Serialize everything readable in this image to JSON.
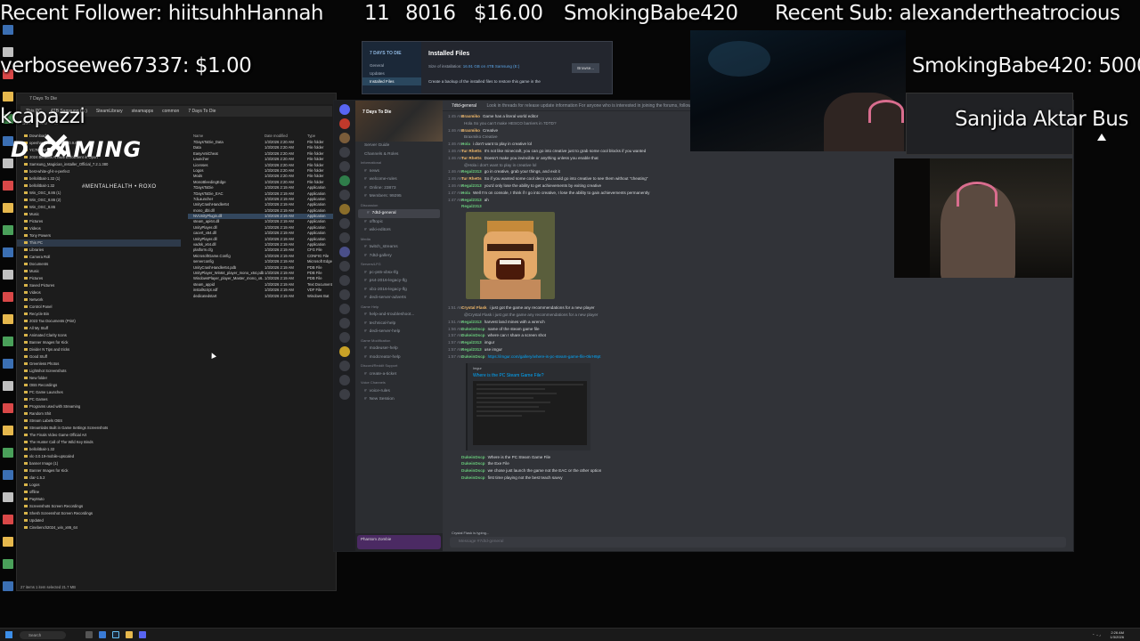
{
  "overlay": {
    "recent_follower": "Recent Follower: hiitsuhhHannah",
    "stat_a": "11",
    "stat_b": "8016",
    "stat_c": "$16.00",
    "top_donor": "SmokingBabe420",
    "recent_sub": "Recent Sub: alexandertheatrocious",
    "tip_line": "verboseewe67337: $1.00",
    "bits_line": "SmokingBabe420: 5000",
    "ticker_left": "kcapazzi",
    "ticker_right": "Sanjida Aktar Bus",
    "logo_text": "D  GAMING",
    "logo_tag": "#MENTALHEALTH • ROXO"
  },
  "steam": {
    "sidebar_title": "7 DAYS TO DIE",
    "sidebar_items": [
      "General",
      "Updates",
      "Installed Files"
    ],
    "heading": "Installed Files",
    "size_label": "Size of installation:",
    "size_value": "16.91 GB on 4TB Samsung (E:)",
    "browse": "Browse...",
    "backup_text": "Create a backup of the installed files to restore this game in the"
  },
  "explorer": {
    "title": "7 Days To Die",
    "address": [
      "This PC",
      "4TB Samsung (E:)",
      "SteamLibrary",
      "steamapps",
      "common",
      "7 Days To Die"
    ],
    "tools": [
      "Sort",
      "View",
      "..."
    ],
    "columns": [
      "Name",
      "Date modified",
      "Type"
    ],
    "nav": [
      "Downloads",
      "openhardwaremonitor-v0.9.6",
      "YC7B-192",
      "2024 Benefits Annual Enrollment in Oport",
      "Samsung_Magician_installer_Official_7.2.1.380",
      "best-white-gf-it-v-perfect",
      "bellolitbait-1.32 (1)",
      "bellolitbait-1.32",
      "Win_OSC_8.86 (1)",
      "Win_OSC_8.86 (2)",
      "Win_OSC_8.86",
      "Music",
      "Pictures",
      "Videos",
      "Tony Powers",
      "This PC",
      "Libraries",
      "Camera Roll",
      "Documents",
      "Music",
      "Pictures",
      "Saved Pictures",
      "Videos",
      "Network",
      "Control Panel",
      "Recycle Bin",
      "2023 Tax Documents (Print)",
      "All My Stuff",
      "Animated Clarity Icons",
      "Banner Images for Kick",
      "Divider N Tips and tricks",
      "Good Stuff",
      "Greenless Photos",
      "Lightshot Screenshots",
      "New folder",
      "OBS Recordings",
      "PC Game Launches",
      "PC Games",
      "Programs used with Streaming",
      "Random Shit",
      "Stream Labels OBS",
      "Streamlabs Built in Game Settings Screenshots",
      "The Finals Video Game Official Art",
      "The Hunter Call of The Wild Key Binds",
      "bellolitbait-1.32",
      "vlc-3.0.19-mobile-upscaled",
      "banner Image (1)",
      "Banner Images for Kick",
      "clar-1.5.2",
      "Logos",
      "offline",
      "PayMuto",
      "Screenshots Screen Recordings",
      "Shesh Screenshot Screen Recordings",
      "Updated",
      "Cinebench2024_win_x86_64"
    ],
    "files": [
      [
        "7DaysToDie_Data",
        "1/3/2026 2:20 AM",
        "File folder"
      ],
      [
        "Data",
        "1/3/2026 2:20 AM",
        "File folder"
      ],
      [
        "EasyAntiCheat",
        "1/3/2026 2:20 AM",
        "File folder"
      ],
      [
        "Launcher",
        "1/3/2026 2:20 AM",
        "File folder"
      ],
      [
        "Licenses",
        "1/3/2026 2:20 AM",
        "File folder"
      ],
      [
        "Logos",
        "1/3/2026 2:20 AM",
        "File folder"
      ],
      [
        "Mods",
        "1/3/2026 2:20 AM",
        "File folder"
      ],
      [
        "MonoBleedingEdge",
        "1/3/2026 2:20 AM",
        "File folder"
      ],
      [
        "7DaysToDie",
        "1/3/2026 2:19 AM",
        "Application"
      ],
      [
        "7DaysToDie_EAC",
        "1/3/2026 2:19 AM",
        "Application"
      ],
      [
        "7dLauncher",
        "1/3/2026 2:19 AM",
        "Application"
      ],
      [
        "UnityCrashHandler64",
        "1/3/2026 2:19 AM",
        "Application"
      ],
      [
        "mono_dbl.dll",
        "1/3/2026 2:19 AM",
        "Application"
      ],
      [
        "NVUnityPlugin.dll",
        "1/3/2026 2:19 AM",
        "Application"
      ],
      [
        "steam_api64.dll",
        "1/3/2026 2:19 AM",
        "Application"
      ],
      [
        "UnityPlayer.dll",
        "1/3/2026 2:19 AM",
        "Application"
      ],
      [
        "cacert_x64.dll",
        "1/3/2026 2:19 AM",
        "Application"
      ],
      [
        "UnityPlayer.dll",
        "1/3/2026 2:19 AM",
        "Application"
      ],
      [
        "vadsk_x64.dll",
        "1/3/2026 2:19 AM",
        "Application"
      ],
      [
        "platform.cfg",
        "1/3/2026 2:19 AM",
        "CFG File"
      ],
      [
        "MicrosoftGame.Config",
        "1/3/2026 2:19 AM",
        "CONFIG File"
      ],
      [
        "serverconfig",
        "1/3/2026 2:19 AM",
        "Microsoft Edge"
      ],
      [
        "UnityCrashHandler64.pdb",
        "1/3/2026 2:19 AM",
        "PDB File"
      ],
      [
        "UnityPlayer_Win64_player_mono_x64.pdb",
        "1/3/2026 2:19 AM",
        "PDB File"
      ],
      [
        "WindowsPlayer_player_Master_mono_x6...",
        "1/3/2026 2:19 AM",
        "PDB File"
      ],
      [
        "steam_appid",
        "1/3/2026 2:19 AM",
        "Text Document"
      ],
      [
        "installscript.vdf",
        "1/3/2026 2:19 AM",
        "VDF File"
      ],
      [
        "dedicatedstart",
        "1/3/2026 2:19 AM",
        "Windows Bat"
      ]
    ],
    "status": "27 items   1 item selected  21.7 MB"
  },
  "discord": {
    "server_name": "7 Days To Die",
    "channel_title": "7dtd-general",
    "topic": "Look in threads for release update information For anyone who is interested in joining the forums, following upd...",
    "channels": [
      {
        "type": "item",
        "label": "Server Guide"
      },
      {
        "type": "item",
        "label": "Channels & Roles"
      },
      {
        "type": "cat",
        "label": "Informational"
      },
      {
        "type": "ch",
        "label": "news"
      },
      {
        "type": "ch",
        "label": "welcome-rules"
      },
      {
        "type": "ch",
        "label": "Online: 23873"
      },
      {
        "type": "ch",
        "label": "Members: 99295"
      },
      {
        "type": "cat",
        "label": "Discussion"
      },
      {
        "type": "ch",
        "label": "7dtd-general",
        "active": true
      },
      {
        "type": "ch",
        "label": "offtopic"
      },
      {
        "type": "ch",
        "label": "wiki-editors"
      },
      {
        "type": "cat",
        "label": "Media"
      },
      {
        "type": "ch",
        "label": "twitch_streams"
      },
      {
        "type": "ch",
        "label": "7dtd-gallery"
      },
      {
        "type": "cat",
        "label": "Servers/LFG"
      },
      {
        "type": "ch",
        "label": "pc-ps5-xbsx-lfg"
      },
      {
        "type": "ch",
        "label": "ps4-2016-legacy-lfg"
      },
      {
        "type": "ch",
        "label": "xb1-2016-legacy-lfg"
      },
      {
        "type": "ch",
        "label": "dedi-server-adverts"
      },
      {
        "type": "cat",
        "label": "Game Help"
      },
      {
        "type": "ch",
        "label": "help-and-troubleshoot..."
      },
      {
        "type": "ch",
        "label": "technical-help"
      },
      {
        "type": "ch",
        "label": "dedi-server-help"
      },
      {
        "type": "cat",
        "label": "Game Modification"
      },
      {
        "type": "ch",
        "label": "modeuser-help"
      },
      {
        "type": "ch",
        "label": "modcreator-help"
      },
      {
        "type": "cat",
        "label": "Discord/Reddit Support"
      },
      {
        "type": "ch",
        "label": "create-a-ticket"
      },
      {
        "type": "cat",
        "label": "Voice Channels"
      },
      {
        "type": "ch",
        "label": "voice-rules"
      },
      {
        "type": "ch",
        "label": "New Session"
      }
    ],
    "user": "Phantom Zombie",
    "messages_top": [
      {
        "ts": "1:45 AM",
        "au": "Braxmiko",
        "c": "o",
        "tx": "Game has a literal world editor"
      },
      {
        "ts": "",
        "au": "",
        "c": "",
        "tx": "Hola So you can't make HESCO barriers in 7DTD?",
        "reply": true
      },
      {
        "ts": "1:46 AM",
        "au": "Braxmiko",
        "c": "o",
        "tx": "Creative"
      },
      {
        "ts": "",
        "au": "",
        "c": "",
        "tx": "Braxmiko Creative",
        "reply": true
      },
      {
        "ts": "1:46 AM",
        "au": "Hola",
        "c": "g",
        "tx": "i don't want to play in creative lol"
      },
      {
        "ts": "1:46 AM",
        "au": "Tur Rhetts",
        "c": "o",
        "tx": "It's not like minecraft, you can go into creative just to grab some cool blocks if you wanted"
      },
      {
        "ts": "1:46 AM",
        "au": "Tur Rhetts",
        "c": "o",
        "tx": "Doesn't make you invincible or anything unless you enable that"
      },
      {
        "ts": "",
        "au": "",
        "c": "",
        "tx": "@Hola i don't want to play in creative lol",
        "reply": true
      },
      {
        "ts": "1:46 AM",
        "au": "Regal2313",
        "c": "g",
        "tx": "go in creative, grab your things, and exit it"
      },
      {
        "ts": "1:46 AM",
        "au": "Tur Rhetts",
        "c": "o",
        "tx": "So if you wanted some cool deco you could go into creative to see them without \"cheating\""
      },
      {
        "ts": "1:46 AM",
        "au": "Regal2313",
        "c": "g",
        "tx": "you'd only lose the ability to get achievements by exiting creative"
      },
      {
        "ts": "1:47 AM",
        "au": "Hola",
        "c": "g",
        "tx": "Well I'm on console, I think if I go into creative, I lose the ability to gain achievements permanently"
      },
      {
        "ts": "1:47 AM",
        "au": "Regal2313",
        "c": "g",
        "tx": "ah"
      },
      {
        "ts": "",
        "au": "Regal2313",
        "c": "g",
        "tx": ""
      }
    ],
    "messages_mid": [
      {
        "ts": "1:51 AM",
        "au": "Crystal Flask",
        "c": "o",
        "tx": "i just got the game any recommendations for a new player"
      },
      {
        "ts": "",
        "au": "",
        "c": "",
        "tx": "@Crystal Flask i just got the game any recommendations for a new player",
        "reply": true
      },
      {
        "ts": "1:51 AM",
        "au": "Regal2313",
        "c": "g",
        "tx": "harvest land mines with a wrench"
      },
      {
        "ts": "1:56 AM",
        "au": "DukeinDscp",
        "c": "g",
        "tx": "name of the steam game file"
      },
      {
        "ts": "1:57 AM",
        "au": "DukeinDscp",
        "c": "g",
        "tx": "where can I share a screen shot"
      },
      {
        "ts": "1:57 AM",
        "au": "Regal2313",
        "c": "g",
        "tx": "imgur"
      },
      {
        "ts": "1:57 AM",
        "au": "Regal2313",
        "c": "g",
        "tx": "use imgur"
      },
      {
        "ts": "1:57 AM",
        "au": "DukeinDscp",
        "c": "g",
        "tx": "https://imgur.com/gallery/where-is-pc-steam-game-file-0krH9pt",
        "link": true
      }
    ],
    "embed_source": "Imgur",
    "embed_title": "Where is the PC Steam Game File?",
    "messages_bottom": [
      {
        "ts": "",
        "au": "DukeinDscp",
        "c": "g",
        "tx": "Where is the PC Steam Game File"
      },
      {
        "ts": "",
        "au": "DukeinDscp",
        "c": "g",
        "tx": "the Exe File"
      },
      {
        "ts": "",
        "au": "DukeinDscp",
        "c": "g",
        "tx": "we chose just launch the game not the EAC or the other option"
      },
      {
        "ts": "",
        "au": "DukeinDscp",
        "c": "g",
        "tx": "first time playing not the best teach savvy"
      }
    ],
    "typing": "Crystal Flask is typing...",
    "input_placeholder": "Message #7dtd-general"
  },
  "taskbar": {
    "search": "Search",
    "time": "2:26 AM",
    "date": "1/3/2026"
  }
}
